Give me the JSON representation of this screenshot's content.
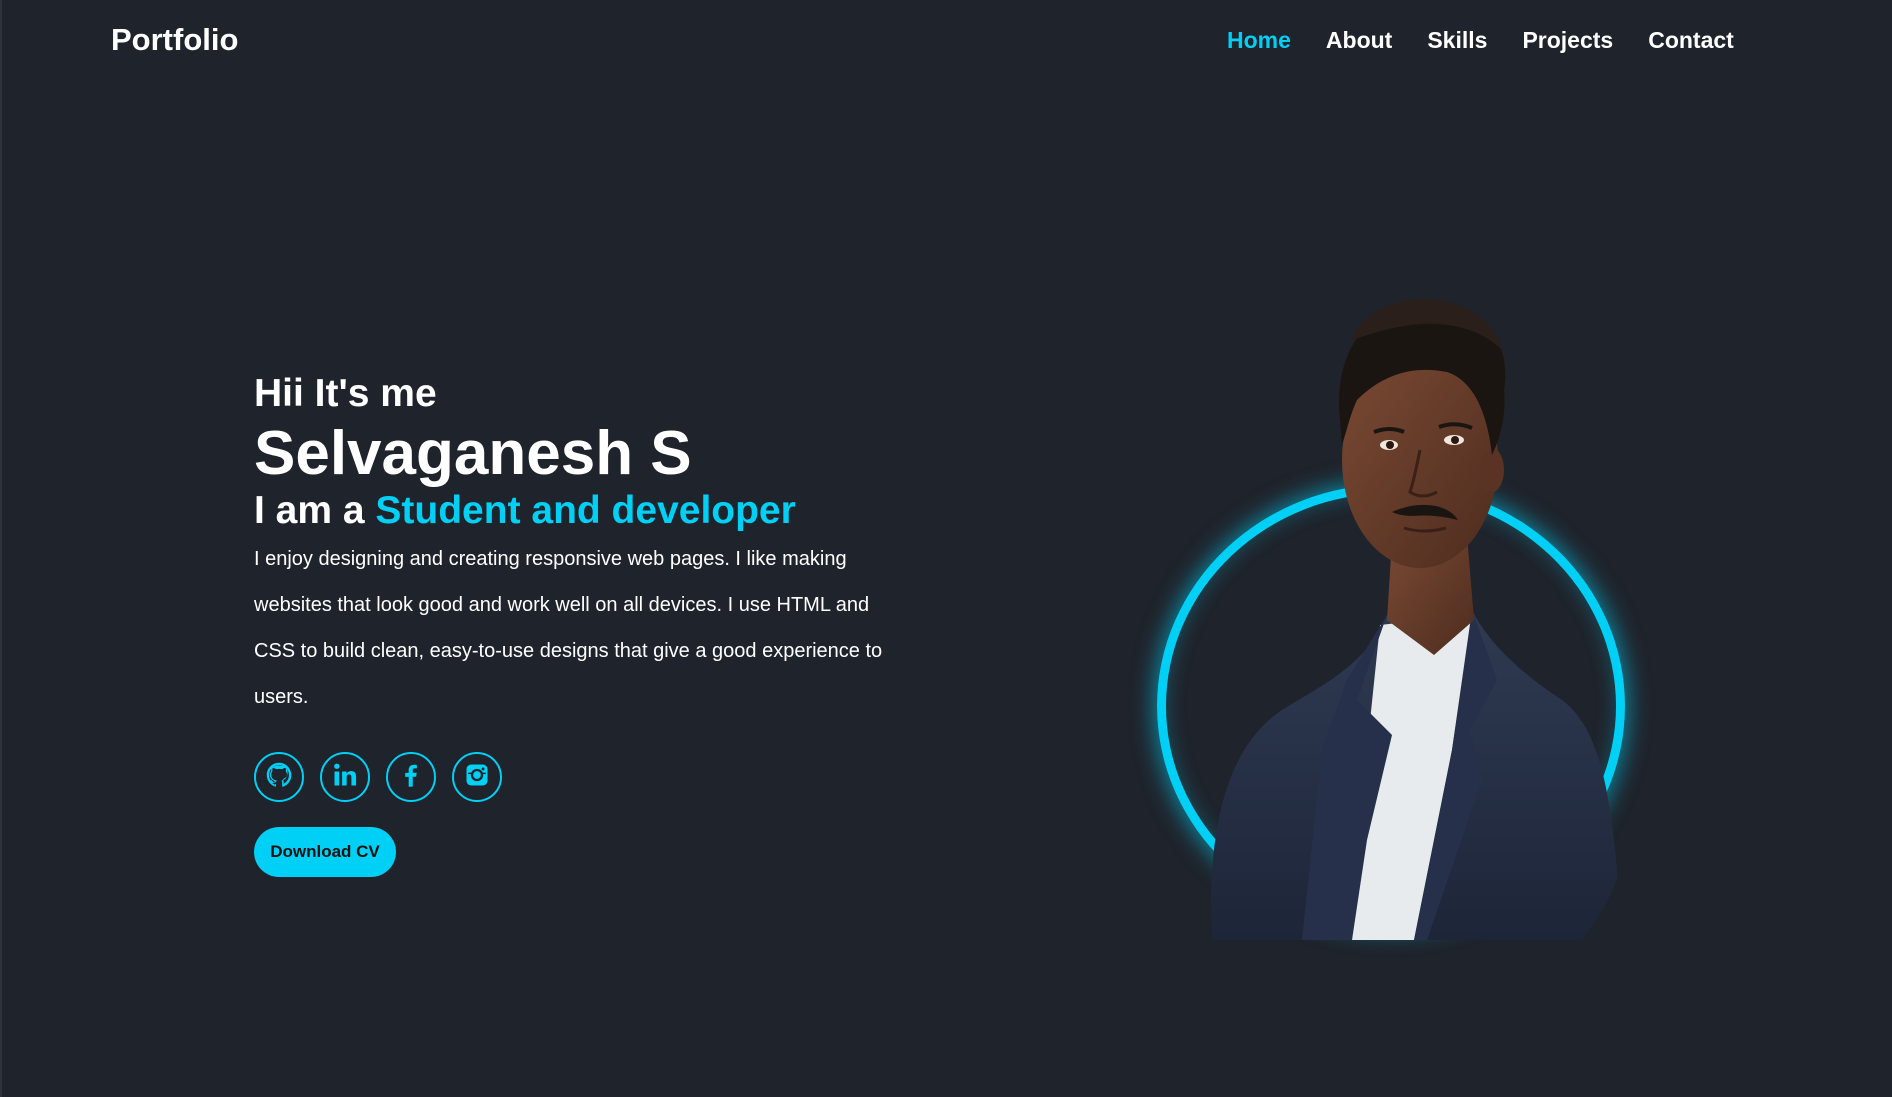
{
  "header": {
    "logo": "Portfolio",
    "nav": [
      {
        "label": "Home",
        "active": true
      },
      {
        "label": "About",
        "active": false
      },
      {
        "label": "Skills",
        "active": false
      },
      {
        "label": "Projects",
        "active": false
      },
      {
        "label": "Contact",
        "active": false
      }
    ]
  },
  "hero": {
    "greeting": "Hii It's me",
    "name": "Selvaganesh S",
    "role_prefix": "I am a ",
    "role_highlight": "Student and developer",
    "description": "I enjoy designing and creating responsive web pages. I like making websites that look good and work well on all devices. I use HTML and CSS to build clean, easy-to-use designs that give a good experience to users.",
    "socials": [
      {
        "icon": "github-icon"
      },
      {
        "icon": "linkedin-icon"
      },
      {
        "icon": "facebook-icon"
      },
      {
        "icon": "instagram-icon"
      }
    ],
    "cv_button": "Download CV"
  },
  "theme": {
    "background": "#1f232b",
    "accent": "#00d0f5",
    "text": "#ffffff"
  }
}
